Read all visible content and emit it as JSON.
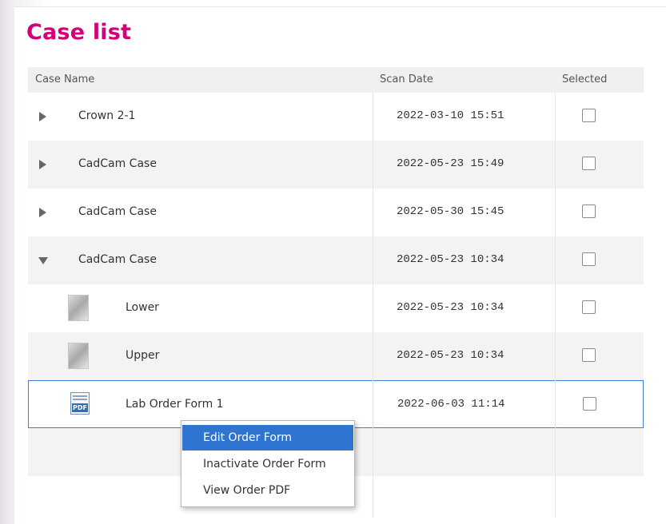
{
  "page": {
    "title": "Case list"
  },
  "table": {
    "columns": [
      "Case Name",
      "Scan Date",
      "Selected"
    ],
    "rows": [
      {
        "name": "Crown 2-1",
        "date": "2022-03-10 15:51",
        "expander": "collapsed"
      },
      {
        "name": "CadCam Case",
        "date": "2022-05-23 15:49",
        "expander": "collapsed"
      },
      {
        "name": "CadCam Case",
        "date": "2022-05-30 15:45",
        "expander": "collapsed"
      },
      {
        "name": "CadCam Case",
        "date": "2022-05-23 10:34",
        "expander": "expanded"
      },
      {
        "name": "Lower",
        "date": "2022-05-23 10:34",
        "icon": "lower-scan-thumbnail"
      },
      {
        "name": "Upper",
        "date": "2022-05-23 10:34",
        "icon": "upper-scan-thumbnail"
      },
      {
        "name": "Lab Order Form 1",
        "date": "2022-06-03 11:14",
        "icon": "pdf-icon",
        "icon_text": "PDF"
      }
    ]
  },
  "context_menu": {
    "items": [
      "Edit Order Form",
      "Inactivate Order Form",
      "View Order PDF"
    ],
    "highlighted": "Edit Order Form"
  },
  "colors": {
    "title": "#d4007a",
    "selection_border": "#3d7fd1",
    "menu_highlight": "#2f74d0"
  }
}
